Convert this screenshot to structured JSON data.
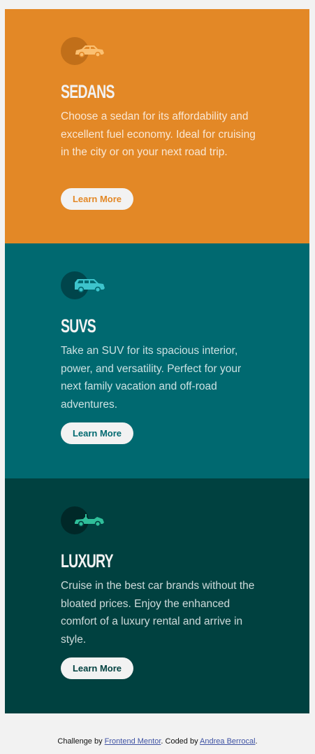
{
  "cards": [
    {
      "title": "Sedans",
      "description": "Choose a sedan for its affordability and excellent fuel economy. Ideal for cruising in the city or on your next road trip.",
      "button_label": "Learn More",
      "icon": "sedan-car-icon",
      "color": "#e38826"
    },
    {
      "title": "SUVs",
      "description": "Take an SUV for its spacious interior, power, and versatility. Perfect for your next family vacation and off-road adventures.",
      "button_label": "Learn More",
      "icon": "suv-car-icon",
      "color": "#006970"
    },
    {
      "title": "Luxury",
      "description": "Cruise in the best car brands without the bloated prices. Enjoy the enhanced comfort of a luxury rental and arrive in style.",
      "button_label": "Learn More",
      "icon": "luxury-car-icon",
      "color": "#004140"
    }
  ],
  "attribution": {
    "prefix": "Challenge by ",
    "link1": "Frontend Mentor",
    "middle": ". Coded by ",
    "link2": "Andrea Berrocal",
    "suffix": "."
  },
  "colors": {
    "background": "#f2f2f2",
    "text_light": "#f2f2f2"
  }
}
